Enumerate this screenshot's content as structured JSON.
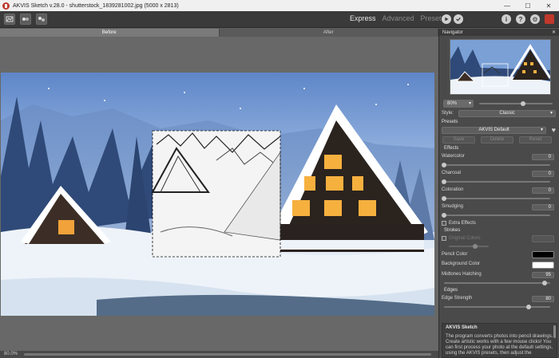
{
  "window": {
    "title": "AKVIS Sketch v.28.0 - shutterstock_1839281002.jpg (5000 x 2813)",
    "minimize": "—",
    "maximize": "☐",
    "close": "✕"
  },
  "toolbar": {
    "modes": [
      "Express",
      "Advanced",
      "Presets"
    ],
    "active_mode": "Express"
  },
  "canvas": {
    "tab_before": "Before",
    "tab_after": "After"
  },
  "status": {
    "zoom": "80.0%"
  },
  "panel": {
    "navigator_title": "Navigator",
    "zoom_value": "80%",
    "zoom_slider": 0.6,
    "style_label": "Style:",
    "style_value": "Classic",
    "presets_label": "Presets",
    "preset_value": "AKVIS Default",
    "save_label": "Save",
    "delete_label": "Delete",
    "reset_label": "Reset",
    "effects_title": "Effects",
    "effects": [
      {
        "label": "Watercolor",
        "value": "0",
        "level": 0
      },
      {
        "label": "Charcoal",
        "value": "0",
        "level": 0
      },
      {
        "label": "Coloration",
        "value": "0",
        "level": 0
      },
      {
        "label": "Smudging",
        "value": "0",
        "level": 0
      }
    ],
    "extra_effects_label": "Extra Effects",
    "strokes_title": "Strokes",
    "original_colors_label": "Original Colors",
    "pencil_color_label": "Pencil Color",
    "background_color_label": "Background Color",
    "pencil_color": "#000000",
    "background_color": "#ffffff",
    "midtones_label": "Midtones Hatching",
    "midtones_value": "95",
    "midtones_level": 0.95,
    "edges_title": "Edges",
    "edge_strength_label": "Edge Strength",
    "edge_strength_value": "80",
    "edge_strength_level": 0.8,
    "help_title": "AKVIS Sketch",
    "help_text": "The program converts photos into pencil drawings. Create artistic works with a few mouse clicks! You can first process your photo at the default settings, using the AKVIS presets, then adjust the"
  }
}
